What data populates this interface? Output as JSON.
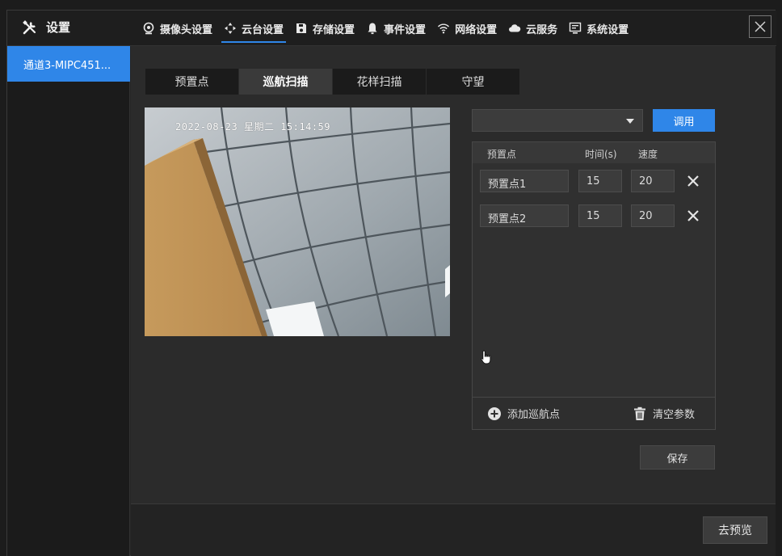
{
  "app": {
    "title": "设置"
  },
  "nav": [
    {
      "label": "摄像头设置",
      "icon": "camera-icon"
    },
    {
      "label": "云台设置",
      "icon": "ptz-icon",
      "active": true
    },
    {
      "label": "存储设置",
      "icon": "save-icon"
    },
    {
      "label": "事件设置",
      "icon": "bell-icon"
    },
    {
      "label": "网络设置",
      "icon": "wifi-icon"
    },
    {
      "label": "云服务",
      "icon": "cloud-icon"
    },
    {
      "label": "系统设置",
      "icon": "monitor-icon"
    }
  ],
  "sidebar": {
    "channel": "通道3-MIPC451..."
  },
  "tabs": [
    {
      "label": "预置点"
    },
    {
      "label": "巡航扫描",
      "active": true
    },
    {
      "label": "花样扫描"
    },
    {
      "label": "守望"
    }
  ],
  "video": {
    "osd": "2022-08-23 星期二 15:14:59"
  },
  "cruise": {
    "selected": "",
    "apply_label": "调用",
    "columns": [
      "预置点",
      "时间(s)",
      "速度"
    ],
    "rows": [
      {
        "preset": "预置点1",
        "time": "15",
        "speed": "20"
      },
      {
        "preset": "预置点2",
        "time": "15",
        "speed": "20"
      }
    ],
    "add_label": "添加巡航点",
    "clear_label": "清空参数",
    "save_label": "保存"
  },
  "footer": {
    "preview_label": "去预览"
  },
  "colors": {
    "accent": "#2f86e8",
    "background": "#2b2b2b",
    "topbar": "#1e1e1e"
  }
}
